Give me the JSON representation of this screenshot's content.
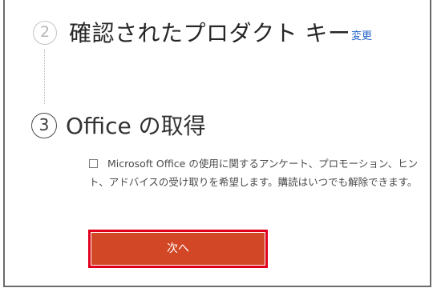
{
  "steps": [
    {
      "number": "2",
      "title": "確認されたプロダクト キー",
      "change_link": "変更"
    },
    {
      "number": "3",
      "title": "Office の取得"
    }
  ],
  "consent": {
    "checked": false,
    "text": "Microsoft Office の使用に関するアンケート、プロモーション、ヒント、アドバイスの受け取りを希望します。購読はいつでも解除できます。"
  },
  "next_button": {
    "label": "次へ"
  },
  "colors": {
    "accent": "#d24726",
    "highlight": "#e0001b",
    "link": "#2463c7"
  }
}
